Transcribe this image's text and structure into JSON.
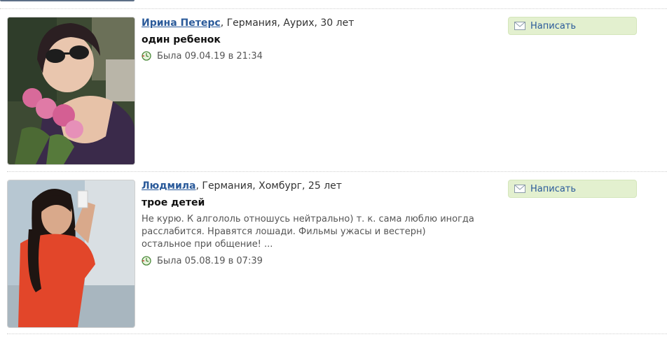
{
  "profiles": [
    {
      "name": "Ирина Петерс",
      "location_age": ", Германия, Аурих, 30 лет",
      "status": "один ребенок",
      "about": "",
      "last_seen": "Была 09.04.19 в 21:34",
      "write_label": "Написать"
    },
    {
      "name": "Людмила",
      "location_age": ", Германия, Хомбург, 25 лет",
      "status": "трое детей",
      "about": "Не курю. К алгололь отношусь нейтрально) т. к. сама люблю иногда расслабится. Нравятся лошади. Фильмы ужасы и вестерн) остальное при общение! ...",
      "last_seen": "Была 05.08.19 в 07:39",
      "write_label": "Написать"
    }
  ]
}
